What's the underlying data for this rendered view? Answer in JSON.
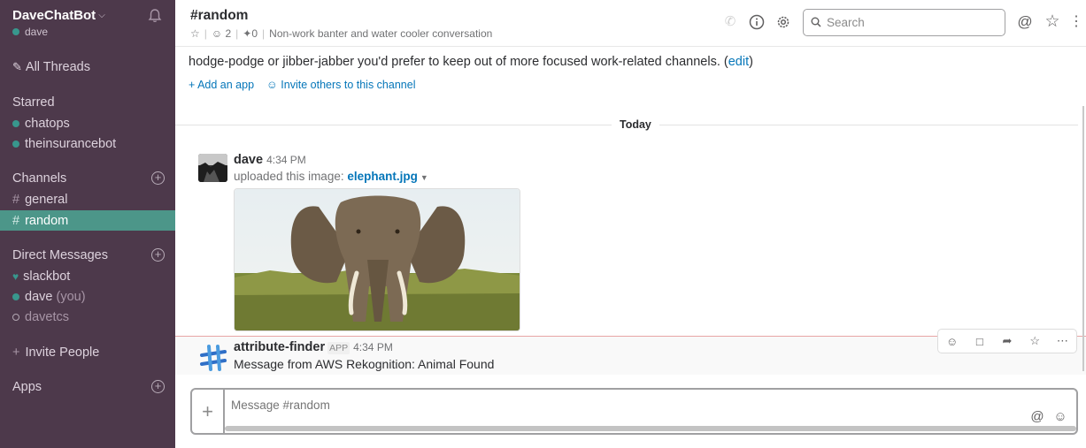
{
  "sidebar": {
    "team_name": "DaveChatBot",
    "user": "dave",
    "all_threads": "All Threads",
    "starred_header": "Starred",
    "starred": [
      "chatops",
      "theinsurancebot"
    ],
    "channels_header": "Channels",
    "channels": [
      "general",
      "random"
    ],
    "active_channel": "random",
    "dm_header": "Direct Messages",
    "dms": [
      {
        "name": "slackbot",
        "suffix": "",
        "status": "heart"
      },
      {
        "name": "dave",
        "suffix": "(you)",
        "status": "online"
      },
      {
        "name": "davetcs",
        "suffix": "",
        "status": "away"
      }
    ],
    "invite": "Invite People",
    "apps_header": "Apps"
  },
  "header": {
    "channel_title": "#random",
    "members": "2",
    "pins": "0",
    "topic": "Non-work banter and water cooler conversation",
    "search_placeholder": "Search"
  },
  "intro": {
    "line": "hodge-podge or jibber-jabber you'd prefer to keep out of more focused work-related channels. (",
    "edit": "edit",
    "close_paren": ")",
    "add_app": "Add an app",
    "invite_others": "Invite others to this channel"
  },
  "day_divider": "Today",
  "messages": [
    {
      "author": "dave",
      "time": "4:34 PM",
      "uploaded_text": "uploaded this image:",
      "file_name": "elephant.jpg"
    },
    {
      "author": "attribute-finder",
      "badge": "APP",
      "time": "4:34 PM",
      "text": "Message from AWS Rekognition: Animal Found"
    }
  ],
  "composer": {
    "placeholder": "Message #random"
  },
  "colors": {
    "sidebar_bg": "#4d394b",
    "active_bg": "#4c9689",
    "link": "#0576b9",
    "presence": "#38978d"
  }
}
